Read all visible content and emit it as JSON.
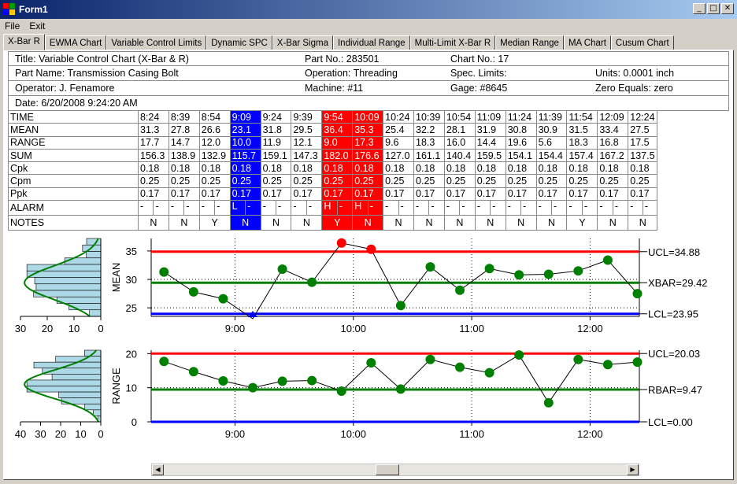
{
  "window": {
    "title": "Form1"
  },
  "menu": [
    "File",
    "Exit"
  ],
  "tabs": [
    "X-Bar R",
    "EWMA Chart",
    "Variable Control Limits",
    "Dynamic SPC",
    "X-Bar Sigma",
    "Individual Range",
    "Multi-Limit X-Bar R",
    "Median Range",
    "MA Chart",
    "Cusum Chart"
  ],
  "info": {
    "title": "Title: Variable Control Chart (X-Bar & R)",
    "part_no": "Part No.: 283501",
    "chart_no": "Chart No.: 17",
    "part_name": "Part Name: Transmission Casing Bolt",
    "operation": "Operation: Threading",
    "spec_limits": "Spec. Limits:",
    "units": "Units: 0.0001 inch",
    "operator": "Operator: J. Fenamore",
    "machine": "Machine: #11",
    "gage": "Gage: #8645",
    "zero_equals": "Zero Equals: zero",
    "date": "Date: 6/20/2008 9:24:20 AM"
  },
  "grid": {
    "row_labels": [
      "TIME",
      "MEAN",
      "RANGE",
      "SUM",
      "Cpk",
      "Cpm",
      "Ppk",
      "ALARM",
      "NOTES"
    ],
    "time": [
      "8:24",
      "8:39",
      "8:54",
      "9:09",
      "9:24",
      "9:39",
      "9:54",
      "10:09",
      "10:24",
      "10:39",
      "10:54",
      "11:09",
      "11:24",
      "11:39",
      "11:54",
      "12:09",
      "12:24"
    ],
    "mean": [
      "31.3",
      "27.8",
      "26.6",
      "23.1",
      "31.8",
      "29.5",
      "36.4",
      "35.3",
      "25.4",
      "32.2",
      "28.1",
      "31.9",
      "30.8",
      "30.9",
      "31.5",
      "33.4",
      "27.5"
    ],
    "range": [
      "17.7",
      "14.7",
      "12.0",
      "10.0",
      "11.9",
      "12.1",
      "9.0",
      "17.3",
      "9.6",
      "18.3",
      "16.0",
      "14.4",
      "19.6",
      "5.6",
      "18.3",
      "16.8",
      "17.5"
    ],
    "sum": [
      "156.3",
      "138.9",
      "132.9",
      "115.7",
      "159.1",
      "147.3",
      "182.0",
      "176.6",
      "127.0",
      "161.1",
      "140.4",
      "159.5",
      "154.1",
      "154.4",
      "157.4",
      "167.2",
      "137.5"
    ],
    "cpk": [
      "0.18",
      "0.18",
      "0.18",
      "0.18",
      "0.18",
      "0.18",
      "0.18",
      "0.18",
      "0.18",
      "0.18",
      "0.18",
      "0.18",
      "0.18",
      "0.18",
      "0.18",
      "0.18",
      "0.18"
    ],
    "cpm": [
      "0.25",
      "0.25",
      "0.25",
      "0.25",
      "0.25",
      "0.25",
      "0.25",
      "0.25",
      "0.25",
      "0.25",
      "0.25",
      "0.25",
      "0.25",
      "0.25",
      "0.25",
      "0.25",
      "0.25"
    ],
    "ppk": [
      "0.17",
      "0.17",
      "0.17",
      "0.17",
      "0.17",
      "0.17",
      "0.17",
      "0.17",
      "0.17",
      "0.17",
      "0.17",
      "0.17",
      "0.17",
      "0.17",
      "0.17",
      "0.17",
      "0.17"
    ],
    "alarm": [
      [
        "-",
        "-"
      ],
      [
        "-",
        "-"
      ],
      [
        "-",
        "-"
      ],
      [
        "L",
        "-"
      ],
      [
        "-",
        "-"
      ],
      [
        "-",
        "-"
      ],
      [
        "H",
        "-"
      ],
      [
        "H",
        "-"
      ],
      [
        "-",
        "-"
      ],
      [
        "-",
        "-"
      ],
      [
        "-",
        "-"
      ],
      [
        "-",
        "-"
      ],
      [
        "-",
        "-"
      ],
      [
        "-",
        "-"
      ],
      [
        "-",
        "-"
      ],
      [
        "-",
        "-"
      ],
      [
        "-",
        "-"
      ]
    ],
    "notes": [
      "N",
      "N",
      "Y",
      "N",
      "N",
      "N",
      "Y",
      "N",
      "N",
      "N",
      "N",
      "N",
      "N",
      "N",
      "Y",
      "N",
      "N"
    ],
    "highlight": [
      "",
      "",
      "",
      "blue",
      "",
      "",
      "red",
      "red",
      "",
      "",
      "",
      "",
      "",
      "",
      "",
      "",
      ""
    ]
  },
  "colors": {
    "ucl": "#ff0000",
    "center": "#008000",
    "lcl": "#0000ff",
    "point": "#008000",
    "alarm_point": "#ff0000",
    "histogram": "#add8e6"
  },
  "chart_data": [
    {
      "type": "line",
      "ylabel": "MEAN",
      "ylim": [
        23.5,
        37.2
      ],
      "yticks": [
        25,
        30,
        35
      ],
      "x": [
        "8:24",
        "8:39",
        "8:54",
        "9:09",
        "9:24",
        "9:39",
        "9:54",
        "10:09",
        "10:24",
        "10:39",
        "10:54",
        "11:09",
        "11:24",
        "11:39",
        "11:54",
        "12:09",
        "12:24"
      ],
      "xticks": [
        "9:00",
        "10:00",
        "11:00",
        "12:00"
      ],
      "values": [
        31.3,
        27.8,
        26.6,
        23.1,
        31.8,
        29.5,
        36.4,
        35.3,
        25.4,
        32.2,
        28.1,
        31.9,
        30.8,
        30.9,
        31.5,
        33.4,
        27.5
      ],
      "alarm": [
        "",
        "",
        "",
        "low",
        "",
        "",
        "high",
        "high",
        "",
        "",
        "",
        "",
        "",
        "",
        "",
        "",
        ""
      ],
      "limits": [
        {
          "label": "UCL=34.88",
          "value": 34.88
        },
        {
          "label": "XBAR=29.42",
          "value": 29.42
        },
        {
          "label": "LCL=23.95",
          "value": 23.95
        }
      ],
      "histogram": {
        "xticks": [
          "30",
          "20",
          "10",
          "0"
        ],
        "xmax": 30
      }
    },
    {
      "type": "line",
      "ylabel": "RANGE",
      "ylim": [
        0,
        21
      ],
      "yticks": [
        0,
        10,
        20
      ],
      "x": [
        "8:24",
        "8:39",
        "8:54",
        "9:09",
        "9:24",
        "9:39",
        "9:54",
        "10:09",
        "10:24",
        "10:39",
        "10:54",
        "11:09",
        "11:24",
        "11:39",
        "11:54",
        "12:09",
        "12:24"
      ],
      "xticks": [
        "9:00",
        "10:00",
        "11:00",
        "12:00"
      ],
      "values": [
        17.7,
        14.7,
        12.0,
        10.0,
        11.9,
        12.1,
        9.0,
        17.3,
        9.6,
        18.3,
        16.0,
        14.4,
        19.6,
        5.6,
        18.3,
        16.8,
        17.5
      ],
      "alarm": [
        "",
        "",
        "",
        "",
        "",
        "",
        "",
        "",
        "",
        "",
        "",
        "",
        "",
        "",
        "",
        "",
        ""
      ],
      "limits": [
        {
          "label": "UCL=20.03",
          "value": 20.03
        },
        {
          "label": "RBAR=9.47",
          "value": 9.47
        },
        {
          "label": "LCL=0.00",
          "value": 0.0
        }
      ],
      "histogram": {
        "xticks": [
          "40",
          "30",
          "20",
          "10",
          "0"
        ],
        "xmax": 40
      }
    }
  ]
}
